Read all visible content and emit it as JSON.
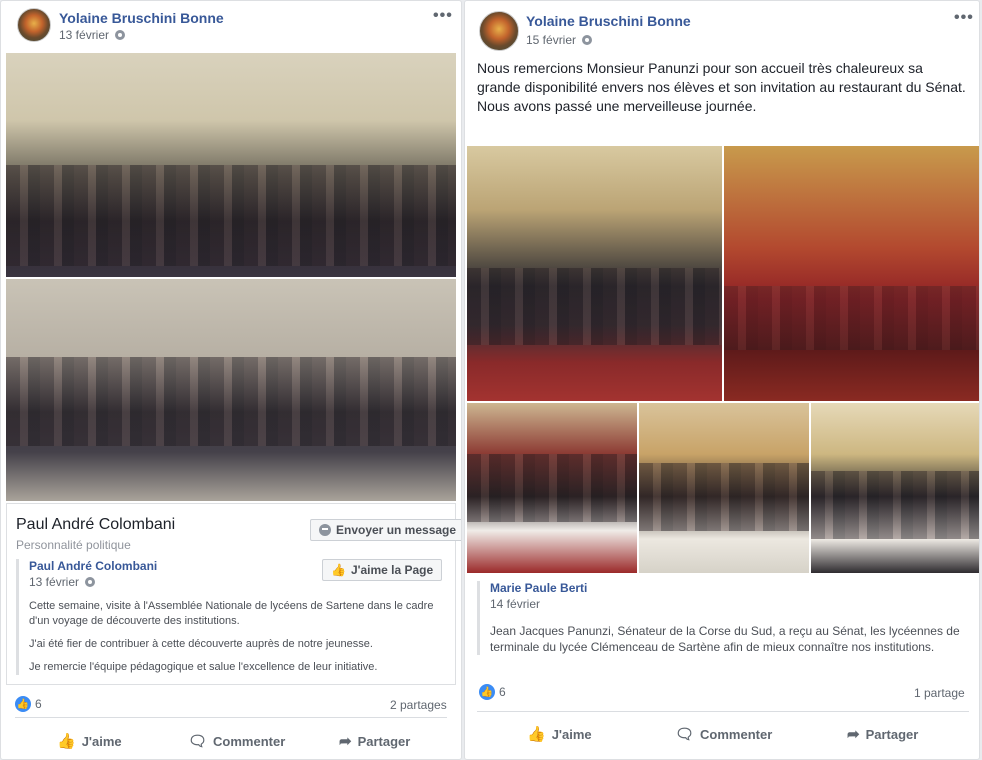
{
  "left_post": {
    "author": "Yolaine Bruschini Bonne",
    "date": "13 février",
    "more": "•••",
    "page_card": {
      "name": "Paul André Colombani",
      "category": "Personnalité politique",
      "message_button": "Envoyer un message",
      "like_page_button": "J'aime la Page"
    },
    "quote": {
      "author": "Paul André Colombani",
      "date": "13 février",
      "paragraphs": [
        "Cette semaine, visite à l'Assemblée Nationale de lycéens de Sartene dans le cadre d'un voyage de découverte des institutions.",
        "J'ai été fier de contribuer à cette découverte auprès de notre jeunesse.",
        "Je remercie l'équipe pédagogique et salue l'excellence de leur initiative."
      ]
    },
    "reactions_count": "6",
    "shares": "2 partages",
    "actions": {
      "like": "J'aime",
      "comment": "Commenter",
      "share": "Partager"
    }
  },
  "right_post": {
    "author": "Yolaine Bruschini Bonne",
    "date": "15 février",
    "more": "•••",
    "text": [
      "Nous remercions Monsieur Panunzi pour son accueil très chaleureux sa grande disponibilité envers nos élèves et son invitation au restaurant du Sénat.",
      "Nous avons passé une merveilleuse journée."
    ],
    "quote": {
      "author": "Marie Paule Berti",
      "date": "14 février",
      "paragraph": "Jean Jacques Panunzi, Sénateur de la Corse du Sud, a reçu au Sénat, les lycéennes de terminale du lycée Clémenceau de Sartène afin de mieux connaître nos institutions."
    },
    "reactions_count": "6",
    "shares": "1 partage",
    "actions": {
      "like": "J'aime",
      "comment": "Commenter",
      "share": "Partager"
    }
  },
  "icons": {
    "globe": "globe-icon",
    "like": "thumbs-up-icon",
    "comment": "comment-icon",
    "share": "share-arrow-icon",
    "messenger": "messenger-icon"
  },
  "colors": {
    "link": "#385898",
    "like_blue": "#3b8cf5",
    "background": "#e9ebee"
  }
}
